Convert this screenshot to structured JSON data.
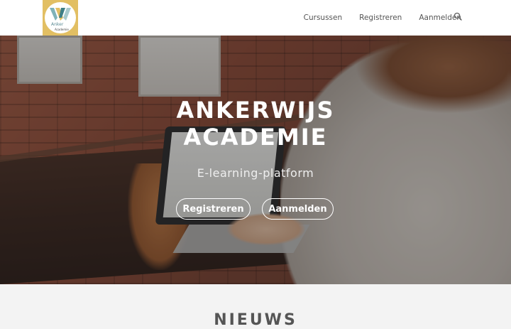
{
  "header": {
    "logo_text": "Anker",
    "logo_sub": "Academie",
    "nav": [
      {
        "label": "Cursussen"
      },
      {
        "label": "Registreren"
      },
      {
        "label": "Aanmelden"
      }
    ],
    "search_icon": "search-icon"
  },
  "hero": {
    "title_line1": "ANKERWIJS",
    "title_line2": "ACADEMIE",
    "subtitle": "E-learning-platform",
    "buttons": {
      "register": "Registreren",
      "login": "Aanmelden"
    }
  },
  "news": {
    "title": "NIEUWS"
  },
  "colors": {
    "logo_background": "#e2bf63",
    "header_background": "#ffffff",
    "section_background": "#f3f3f3",
    "nav_text": "#555555"
  }
}
